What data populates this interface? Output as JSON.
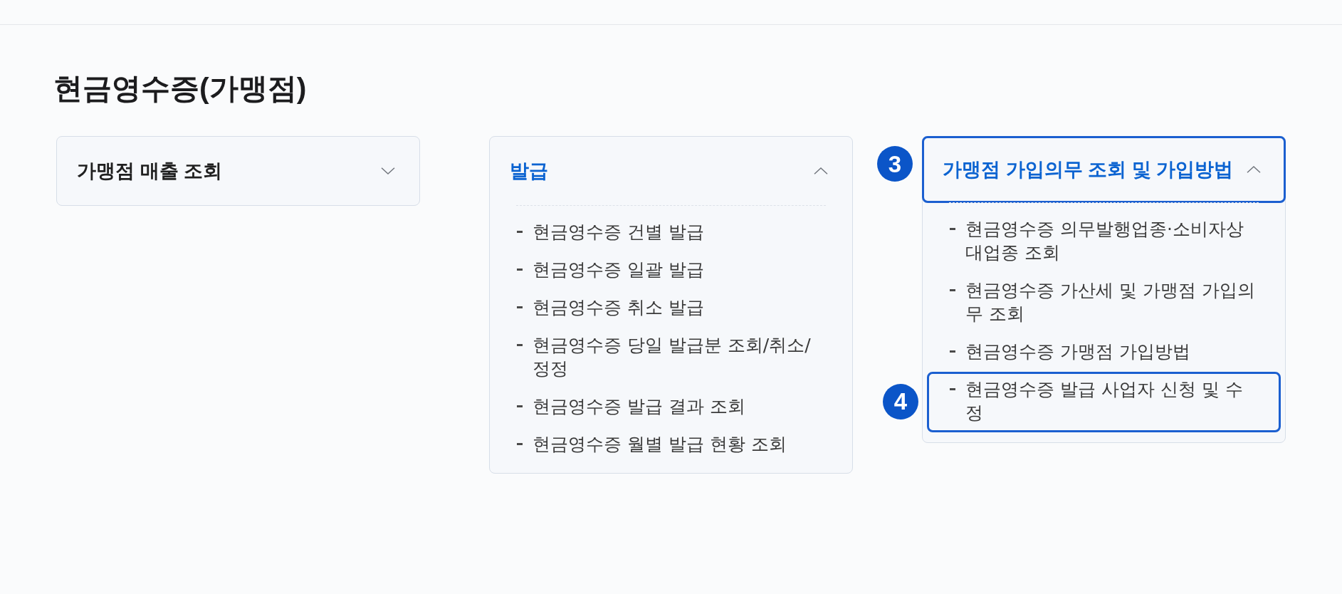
{
  "page": {
    "title": "현금영수증(가맹점)"
  },
  "menus": [
    {
      "title": "가맹점 매출 조회",
      "expanded": false
    },
    {
      "title": "발급",
      "expanded": true,
      "items": [
        {
          "text": "현금영수증 건별 발급"
        },
        {
          "text": "현금영수증 일괄 발급"
        },
        {
          "text": "현금영수증 취소 발급"
        },
        {
          "text": "현금영수증 당일 발급분 조회/취소/정정"
        },
        {
          "text": "현금영수증 발급 결과 조회"
        },
        {
          "text": "현금영수증 월별 발급 현황 조회"
        }
      ]
    },
    {
      "title": "가맹점 가입의무 조회 및 가입방법",
      "expanded": true,
      "callout": "3",
      "items": [
        {
          "text": "현금영수증 의무발행업종·소비자상대업종 조회"
        },
        {
          "text": "현금영수증 가산세 및 가맹점 가입의무 조회"
        },
        {
          "text": "현금영수증 가맹점 가입방법"
        },
        {
          "text": "현금영수증 발급 사업자 신청 및 수정",
          "callout": "4"
        }
      ]
    }
  ]
}
